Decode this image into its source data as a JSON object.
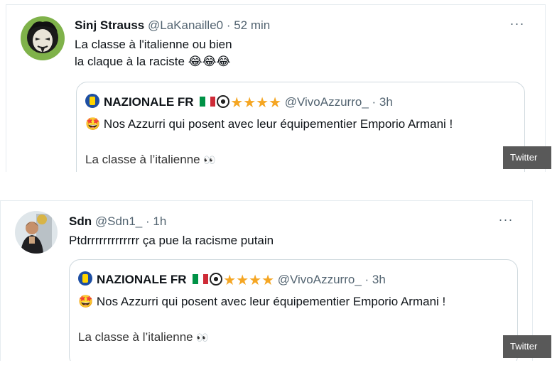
{
  "tweets": [
    {
      "name": "Sinj Strauss",
      "handle": "@LaKanaille0",
      "dot": " · ",
      "time": "52 min",
      "more": "···",
      "text_line1": "La classe à l'italienne ou bien",
      "text_line2": "la claque à la raciste",
      "emojis": "😂😂😂",
      "quote": {
        "name": "NAZIONALE FR",
        "stars": "★★★★",
        "handle": "@VivoAzzurro_",
        "dot": " · ",
        "time": "3h",
        "line1_emoji": "🤩",
        "line1": "Nos Azzurri qui posent avec leur équipementier Emporio Armani !",
        "line2": "La classe à l’italienne",
        "eyes": "👀"
      },
      "watermark": "Twitter"
    },
    {
      "name": "Sdn",
      "handle": "@Sdn1_",
      "dot": " · ",
      "time": "1h",
      "more": "···",
      "text_line1": "Ptdrrrrrrrrrrrrr ça pue la racisme putain",
      "quote": {
        "name": "NAZIONALE FR",
        "stars": "★★★★",
        "handle": "@VivoAzzurro_",
        "dot": " · ",
        "time": "3h",
        "line1_emoji": "🤩",
        "line1": "Nos Azzurri qui posent avec leur équipementier Emporio Armani !",
        "line2": "La classe à l’italienne",
        "eyes": "👀"
      },
      "watermark": "Twitter"
    }
  ],
  "colors": {
    "text": "#0f1419",
    "secondary": "#536471",
    "border": "#cfd9de",
    "star": "#f5a623",
    "watermark_bg": "#595959"
  },
  "icons": [
    "more-icon",
    "avatar",
    "italy-flag-icon",
    "soccer-ball-icon",
    "star-icon",
    "nazionale-logo-icon"
  ]
}
